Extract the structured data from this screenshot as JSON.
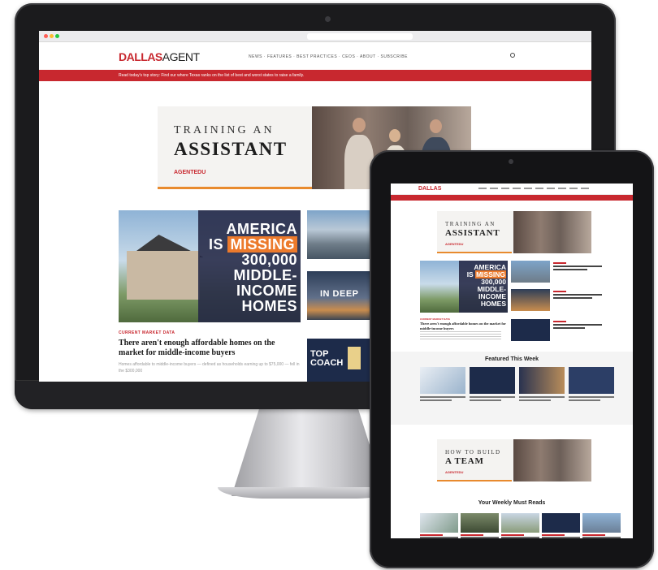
{
  "desktop": {
    "logo_part1": "DALLAS",
    "logo_part2": "AGENT",
    "nav_text": "NEWS · FEATURES · BEST PRACTICES · CEOS · ABOUT · SUBSCRIBE",
    "ribbon_text": "Read today's top story: Find our where Texas ranks on the list of best and worst states to raise a family.",
    "promo": {
      "line1": "TRAINING AN",
      "line2": "ASSISTANT",
      "brand": "AGENTEDU"
    },
    "hero": {
      "line1": "AMERICA",
      "line2_pre": "IS ",
      "line2_highlight": "MISSING",
      "line3": "300,000",
      "line4": "MIDDLE-",
      "line5": "INCOME",
      "line6": "HOMES"
    },
    "kicker": "CURRENT MARKET DATA",
    "headline": "There aren't enough affordable homes on the market for middle-income buyers",
    "excerpt": "Homes affordable to middle-income buyers — defined as households earning up to $75,000 — fell in the $300,000",
    "thumb2_overlay": "IN DEEP",
    "thumb3_overlay_1": "TOP",
    "thumb3_overlay_2": "COACH"
  },
  "tablet": {
    "logo": "DALLAS",
    "promo": {
      "line1": "TRAINING AN",
      "line2": "ASSISTANT",
      "brand": "AGENTEDU"
    },
    "hero": {
      "line1": "AMERICA",
      "line2_pre": "IS ",
      "line2_highlight": "MISSING",
      "line3": "300,000",
      "line4": "MIDDLE-",
      "line5": "INCOME",
      "line6": "HOMES"
    },
    "kicker": "CURRENT MARKET DATA",
    "headline": "There aren't enough affordable homes on the market for middle-income buyers",
    "featured_title": "Featured This Week",
    "promo2": {
      "line1": "HOW TO BUILD",
      "line2": "A TEAM",
      "brand": "AGENTEDU"
    },
    "must_reads_title": "Your Weekly Must Reads"
  },
  "colors": {
    "brand_red": "#c8282f",
    "accent_orange": "#ec7a2c",
    "navy": "#242846"
  },
  "icons": [
    "search-icon",
    "camera-icon"
  ]
}
